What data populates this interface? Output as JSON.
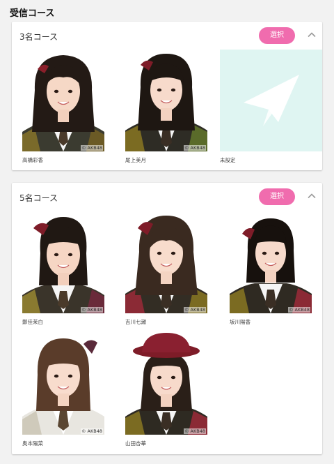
{
  "page": {
    "title": "受信コース"
  },
  "courses": [
    {
      "title": "3名コース",
      "select_label": "選択",
      "members": [
        {
          "name": "高橋彩香",
          "copyright": "© AKB48"
        },
        {
          "name": "尾上美月",
          "copyright": "© AKB48"
        },
        {
          "name": "未設定"
        }
      ]
    },
    {
      "title": "5名コース",
      "select_label": "選択",
      "members": [
        {
          "name": "鄭佳茉白",
          "copyright": "© AKB48"
        },
        {
          "name": "吉川七瀬",
          "copyright": "© AKB48"
        },
        {
          "name": "坂川陽香",
          "copyright": "© AKB48"
        },
        {
          "name": "奥本陽菜",
          "copyright": "© AKB48"
        },
        {
          "name": "山田杏華",
          "copyright": "© AKB48"
        }
      ]
    }
  ],
  "colors": {
    "accent": "#f06cae",
    "unset_tile": "#dff5f2",
    "unset_icon": "#ffffff"
  },
  "icons": {
    "collapse": "chevron-up-icon",
    "unset": "paper-plane-icon"
  }
}
